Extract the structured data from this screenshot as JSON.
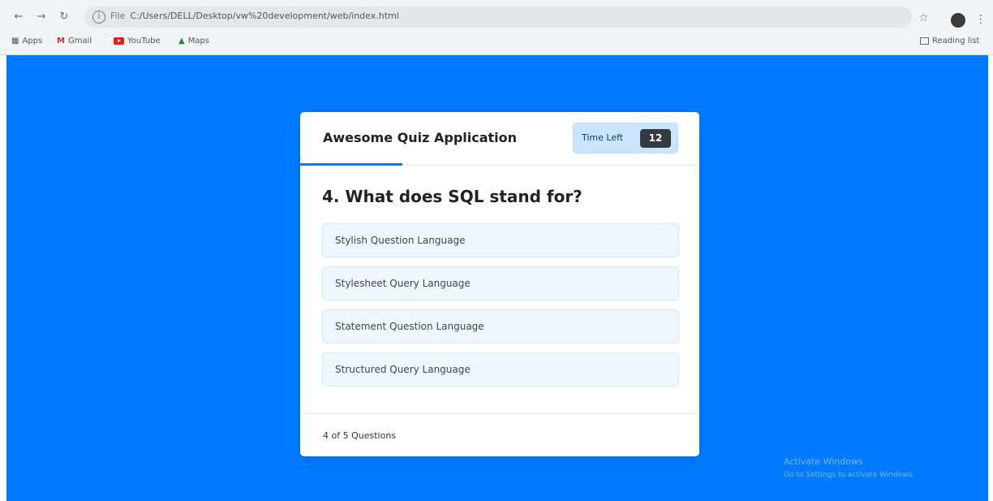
{
  "browser": {
    "address": {
      "scheme": "File",
      "path": "C:/Users/DELL/Desktop/vw%20development/web/index.html"
    },
    "bookmarks": [
      {
        "label": "Apps",
        "icon": "apps-icon"
      },
      {
        "label": "Gmail",
        "icon": "gmail-icon"
      },
      {
        "label": "YouTube",
        "icon": "youtube-icon"
      },
      {
        "label": "Maps",
        "icon": "maps-icon"
      }
    ],
    "reading_list": "Reading list",
    "profile_initial": "●"
  },
  "quiz": {
    "app_title": "Awesome Quiz Application",
    "timer_label": "Time Left",
    "timer_seconds": "12",
    "question": "4. What does SQL stand for?",
    "options": [
      "Stylish Question Language",
      "Stylesheet Query Language",
      "Statement Question Language",
      "Structured Query Language"
    ],
    "footer_count": "4 of 5 Questions"
  },
  "watermark": {
    "title": "Activate Windows",
    "subtitle": "Go to Settings to activate Windows."
  },
  "colors": {
    "page_background": "#007bff",
    "timer_background": "#cce5ff",
    "timer_badge": "#343a40",
    "option_background": "#eef6ff"
  }
}
